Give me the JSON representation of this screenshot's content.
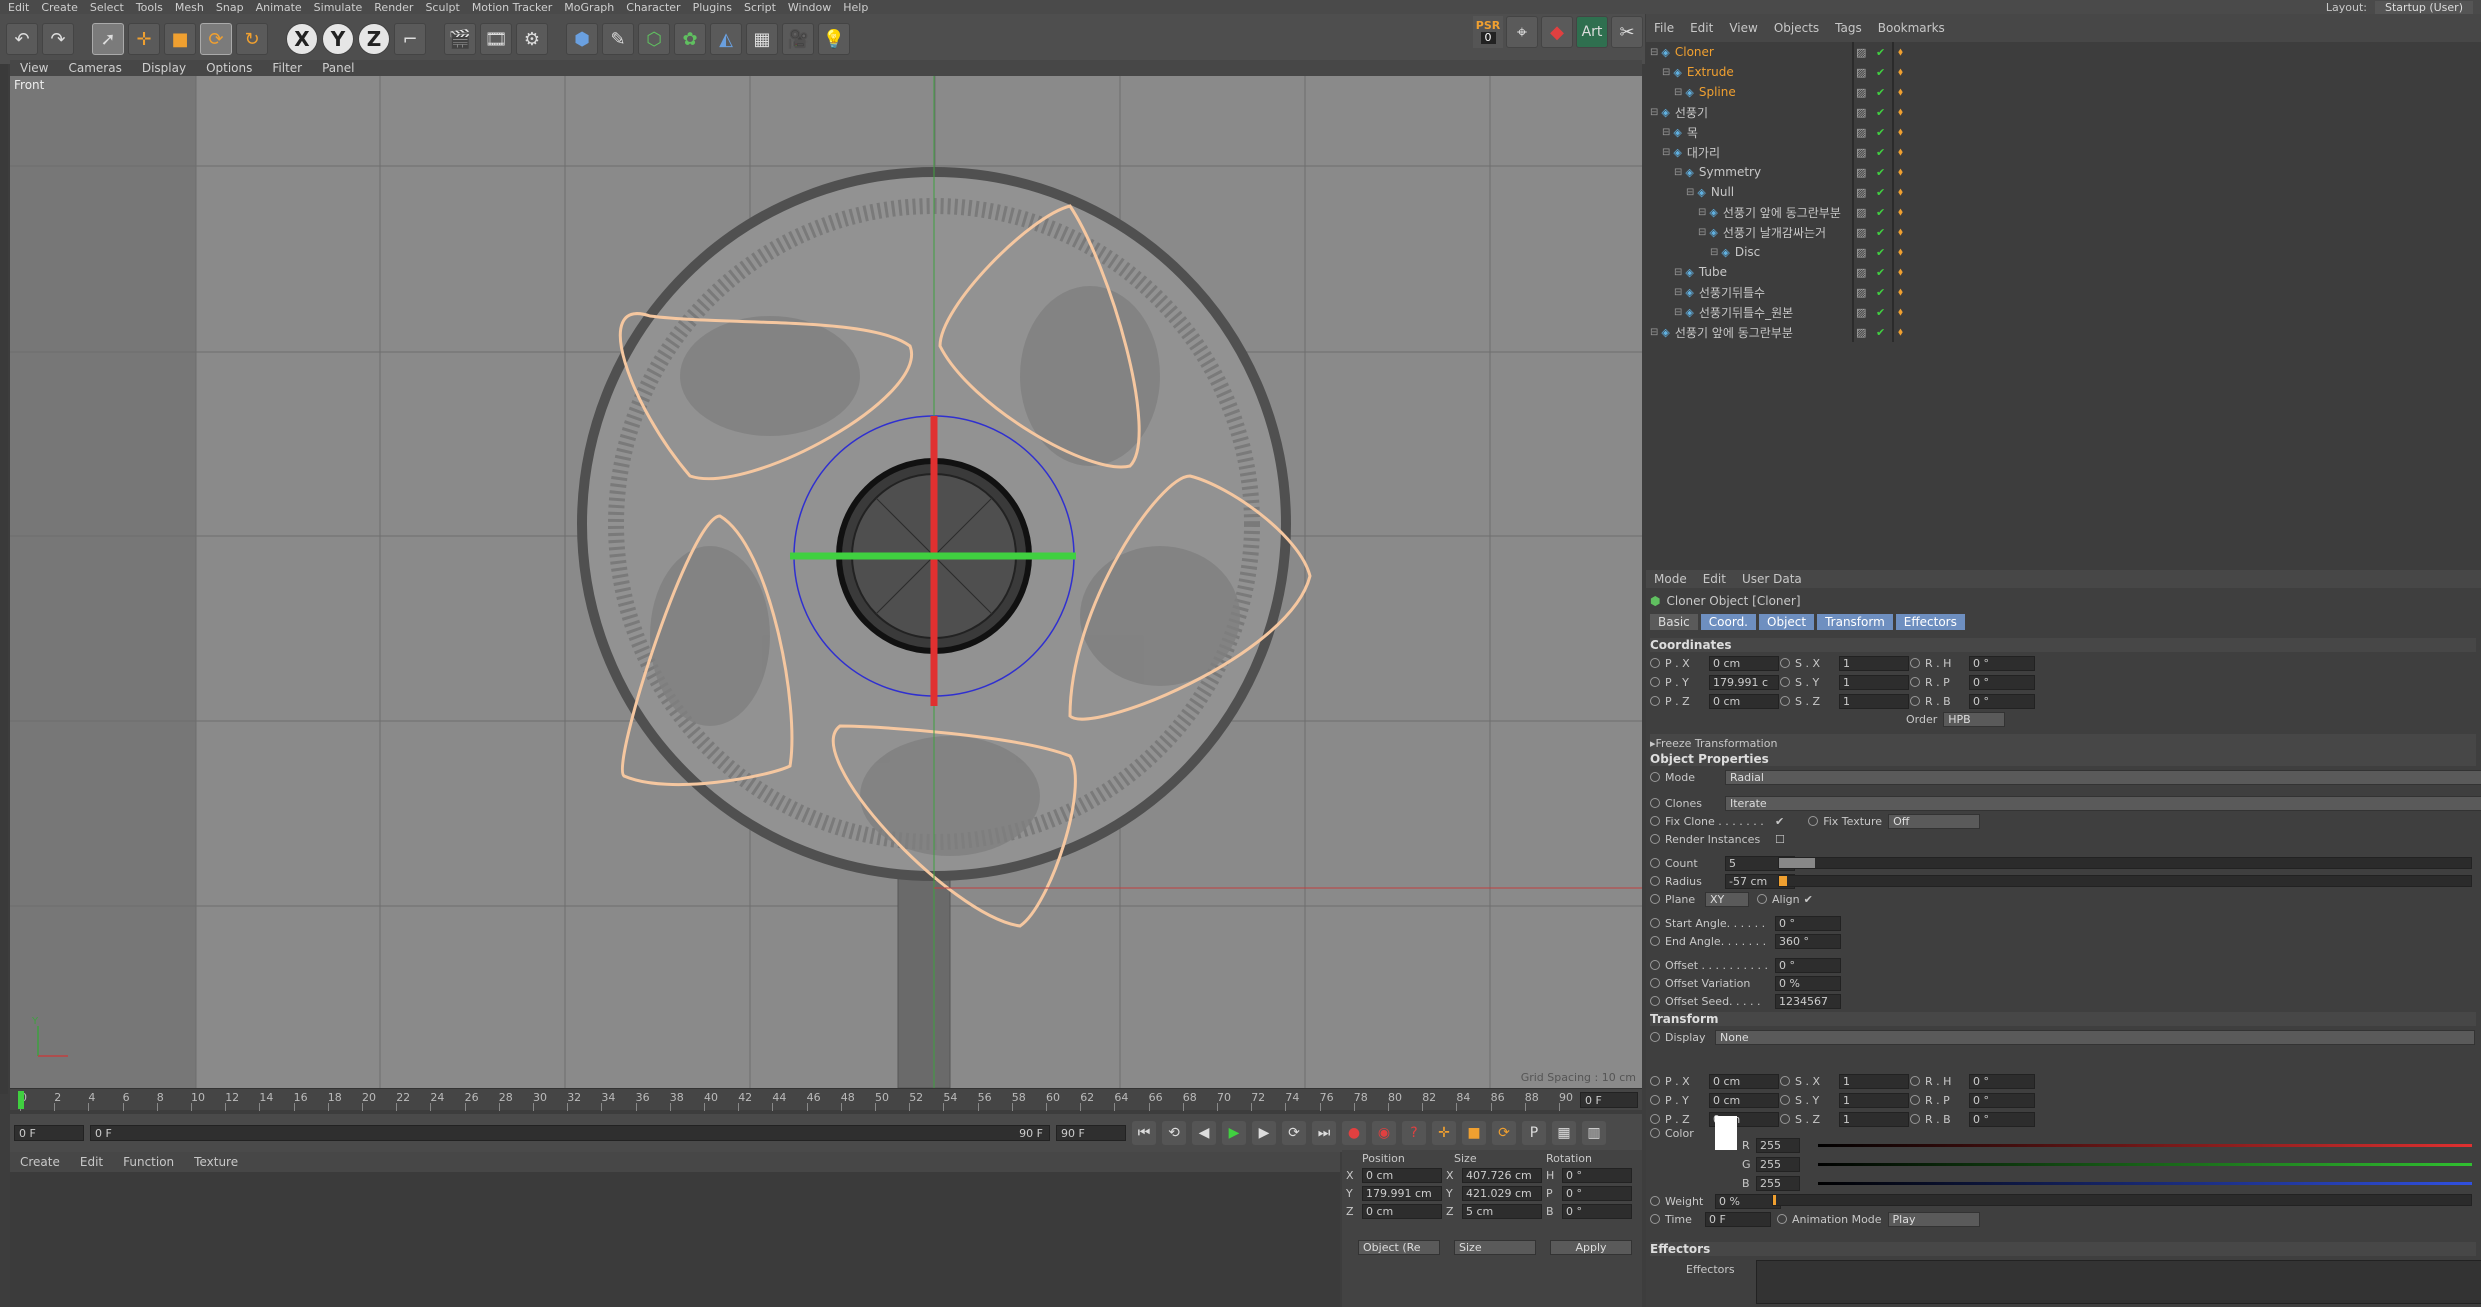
{
  "menubar": {
    "items": [
      "Edit",
      "Create",
      "Select",
      "Tools",
      "Mesh",
      "Snap",
      "Animate",
      "Simulate",
      "Render",
      "Sculpt",
      "Motion Tracker",
      "MoGraph",
      "Character",
      "Plugins",
      "Script",
      "Window",
      "Help"
    ],
    "layout_label": "Layout:",
    "layout_value": "Startup (User)"
  },
  "toolbar": {
    "psr_label": "PSR",
    "psr_value": "0",
    "art_label": "Art",
    "axis_x": "X",
    "axis_y": "Y",
    "axis_z": "Z"
  },
  "viewport": {
    "menu": [
      "View",
      "Cameras",
      "Display",
      "Options",
      "Filter",
      "Panel"
    ],
    "label": "Front",
    "grid_spacing": "Grid Spacing : 10 cm",
    "axis_y": "Y"
  },
  "timeline": {
    "ticks": [
      0,
      2,
      4,
      6,
      8,
      10,
      12,
      14,
      16,
      18,
      20,
      22,
      24,
      26,
      28,
      30,
      32,
      34,
      36,
      38,
      40,
      42,
      44,
      46,
      48,
      50,
      52,
      54,
      56,
      58,
      60,
      62,
      64,
      66,
      68,
      70,
      72,
      74,
      76,
      78,
      80,
      82,
      84,
      86,
      88,
      90
    ],
    "current_frame": "0 F",
    "start": "0 F",
    "end_small": "90 F",
    "end": "90 F",
    "frame_right": "0 F"
  },
  "material": {
    "menu": [
      "Create",
      "Edit",
      "Function",
      "Texture"
    ]
  },
  "coords": {
    "headers": [
      "Position",
      "Size",
      "Rotation"
    ],
    "rows": [
      {
        "a": "X",
        "pv": "0 cm",
        "b": "X",
        "sv": "407.726 cm",
        "c": "H",
        "rv": "0 °"
      },
      {
        "a": "Y",
        "pv": "179.991 cm",
        "b": "Y",
        "sv": "421.029 cm",
        "c": "P",
        "rv": "0 °"
      },
      {
        "a": "Z",
        "pv": "0 cm",
        "b": "Z",
        "sv": "5 cm",
        "c": "B",
        "rv": "0 °"
      }
    ],
    "mode": "Object (Re",
    "size_mode": "Size",
    "apply": "Apply"
  },
  "object_manager": {
    "menu": [
      "File",
      "Edit",
      "View",
      "Objects",
      "Tags",
      "Bookmarks"
    ],
    "objects": [
      {
        "name": "Cloner",
        "indent": 0,
        "color": "#f0a030"
      },
      {
        "name": "Extrude",
        "indent": 1,
        "color": "#f0a030"
      },
      {
        "name": "Spline",
        "indent": 2,
        "color": "#f0a030"
      },
      {
        "name": "선풍기",
        "indent": 0,
        "color": "#c8c8c8"
      },
      {
        "name": "목",
        "indent": 1,
        "color": "#c8c8c8"
      },
      {
        "name": "대가리",
        "indent": 1,
        "color": "#c8c8c8"
      },
      {
        "name": "Symmetry",
        "indent": 2,
        "color": "#c8c8c8"
      },
      {
        "name": "Null",
        "indent": 3,
        "color": "#c8c8c8"
      },
      {
        "name": "선풍기 앞에 동그란부분",
        "indent": 4,
        "color": "#c8c8c8"
      },
      {
        "name": "선풍기 날개감싸는거",
        "indent": 4,
        "color": "#c8c8c8"
      },
      {
        "name": "Disc",
        "indent": 5,
        "color": "#c8c8c8"
      },
      {
        "name": "Tube",
        "indent": 2,
        "color": "#c8c8c8"
      },
      {
        "name": "선풍기뒤틀수",
        "indent": 2,
        "color": "#c8c8c8"
      },
      {
        "name": "선풍기뒤틀수_원본",
        "indent": 2,
        "color": "#c8c8c8"
      },
      {
        "name": "선풍기 앞에 동그란부분",
        "indent": 0,
        "color": "#c8c8c8"
      }
    ]
  },
  "attributes": {
    "menu": [
      "Mode",
      "Edit",
      "User Data"
    ],
    "title": "Cloner Object [Cloner]",
    "tabs": [
      "Basic",
      "Coord.",
      "Object",
      "Transform",
      "Effectors"
    ],
    "coordinates_title": "Coordinates",
    "coord_rows": [
      {
        "p": "P . X",
        "pv": "0 cm",
        "s": "S . X",
        "sv": "1",
        "r": "R . H",
        "rv": "0 °"
      },
      {
        "p": "P . Y",
        "pv": "179.991 c",
        "s": "S . Y",
        "sv": "1",
        "r": "R . P",
        "rv": "0 °"
      },
      {
        "p": "P . Z",
        "pv": "0 cm",
        "s": "S . Z",
        "sv": "1",
        "r": "R . B",
        "rv": "0 °"
      }
    ],
    "order_label": "Order",
    "order_value": "HPB",
    "freeze": "Freeze Transformation",
    "object_props": "Object Properties",
    "mode_label": "Mode",
    "mode_value": "Radial",
    "clones_label": "Clones",
    "clones_value": "Iterate",
    "fix_clone": "Fix Clone . . . . . . .",
    "fix_texture": "Fix Texture",
    "fix_texture_value": "Off",
    "render_instances": "Render Instances",
    "count_label": "Count",
    "count_value": "5",
    "radius_label": "Radius",
    "radius_value": "-57 cm",
    "plane_label": "Plane",
    "plane_value": "XY",
    "align_label": "Align",
    "start_angle_label": "Start Angle. . . . . .",
    "start_angle": "0 °",
    "end_angle_label": "End Angle. . . . . . .",
    "end_angle": "360 °",
    "offset_label": "Offset . . . . . . . . . .",
    "offset": "0 °",
    "offset_var_label": "Offset Variation",
    "offset_var": "0 %",
    "offset_seed_label": "Offset Seed. . . . .",
    "offset_seed": "1234567",
    "transform_title": "Transform",
    "display_label": "Display",
    "display_value": "None",
    "t_rows": [
      {
        "p": "P . X",
        "pv": "0 cm",
        "s": "S . X",
        "sv": "1",
        "r": "R . H",
        "rv": "0 °"
      },
      {
        "p": "P . Y",
        "pv": "0 cm",
        "s": "S . Y",
        "sv": "1",
        "r": "R . P",
        "rv": "0 °"
      },
      {
        "p": "P . Z",
        "pv": "0 cm",
        "s": "S . Z",
        "sv": "1",
        "r": "R . B",
        "rv": "0 °"
      }
    ],
    "color_label": "Color",
    "r_label": "R",
    "g_label": "G",
    "b_label": "B",
    "rv": "255",
    "gv": "255",
    "bv": "255",
    "weight_label": "Weight",
    "weight": "0 %",
    "time_label": "Time",
    "time": "0 F",
    "anim_mode_label": "Animation Mode",
    "anim_mode": "Play",
    "effectors_title": "Effectors",
    "effectors_label": "Effectors"
  }
}
